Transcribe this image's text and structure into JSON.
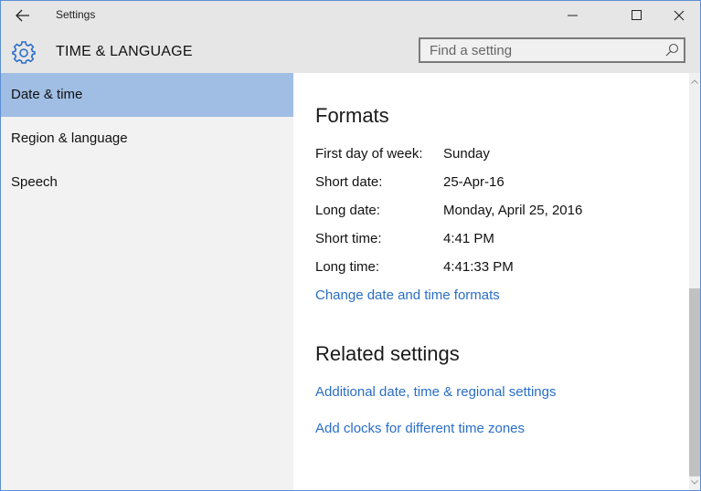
{
  "window": {
    "title": "Settings",
    "controls": {
      "minimize": "minimize-icon",
      "maximize": "maximize-icon",
      "close": "close-icon"
    },
    "back_icon": "back-arrow-icon"
  },
  "header": {
    "icon": "gear-icon",
    "title": "TIME & LANGUAGE",
    "search": {
      "placeholder": "Find a setting",
      "value": "",
      "icon": "search-icon"
    }
  },
  "sidebar": {
    "items": [
      {
        "label": "Date & time",
        "active": true
      },
      {
        "label": "Region & language",
        "active": false
      },
      {
        "label": "Speech",
        "active": false
      }
    ]
  },
  "main": {
    "formats": {
      "heading": "Formats",
      "rows": [
        {
          "label": "First day of week:",
          "value": "Sunday"
        },
        {
          "label": "Short date:",
          "value": "25-Apr-16"
        },
        {
          "label": "Long date:",
          "value": "Monday, April 25, 2016"
        },
        {
          "label": "Short time:",
          "value": "4:41 PM"
        },
        {
          "label": "Long time:",
          "value": "4:41:33 PM"
        }
      ],
      "change_link": "Change date and time formats"
    },
    "related": {
      "heading": "Related settings",
      "links": [
        "Additional date, time & regional settings",
        "Add clocks for different time zones"
      ]
    }
  },
  "colors": {
    "accent": "#2a6ec8",
    "selected_nav": "#a0bde3",
    "window_border": "#5b8fd1"
  }
}
